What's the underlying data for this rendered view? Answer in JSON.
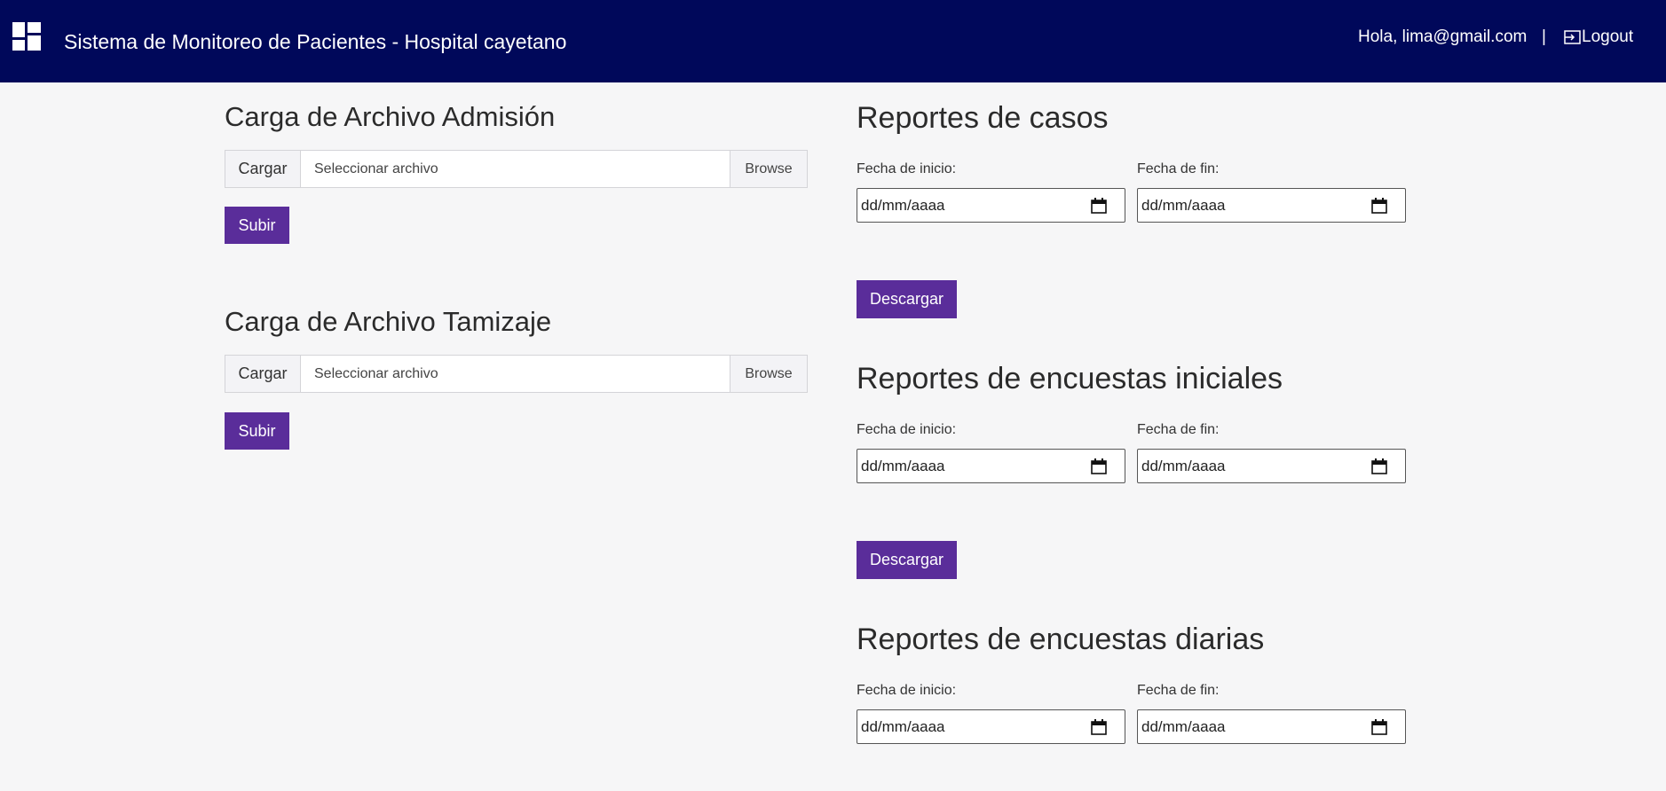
{
  "header": {
    "title": "Sistema de Monitoreo de Pacientes - Hospital cayetano",
    "greeting": "Hola, lima@gmail.com",
    "separator": "|",
    "logout_label": "Logout",
    "logo_icon": "dashboard-grid-icon",
    "logout_icon": "logout-arrow-icon"
  },
  "uploads": [
    {
      "title": "Carga de Archivo Admisión",
      "prefix": "Cargar",
      "placeholder": "Seleccionar archivo",
      "browse_label": "Browse",
      "submit_label": "Subir"
    },
    {
      "title": "Carga de Archivo Tamizaje",
      "prefix": "Cargar",
      "placeholder": "Seleccionar archivo",
      "browse_label": "Browse",
      "submit_label": "Subir"
    }
  ],
  "reports": [
    {
      "title": "Reportes de casos",
      "start_label": "Fecha de inicio:",
      "end_label": "Fecha de fin:",
      "start_value": "dd/mm/aaaa",
      "end_value": "dd/mm/aaaa",
      "download_label": "Descargar"
    },
    {
      "title": "Reportes de encuestas iniciales",
      "start_label": "Fecha de inicio:",
      "end_label": "Fecha de fin:",
      "start_value": "dd/mm/aaaa",
      "end_value": "dd/mm/aaaa",
      "download_label": "Descargar"
    },
    {
      "title": "Reportes de encuestas diarias",
      "start_label": "Fecha de inicio:",
      "end_label": "Fecha de fin:",
      "start_value": "dd/mm/aaaa",
      "end_value": "dd/mm/aaaa"
    }
  ],
  "colors": {
    "header_bg": "#00085a",
    "accent": "#5a2d9a",
    "page_bg": "#f6f6f7"
  }
}
